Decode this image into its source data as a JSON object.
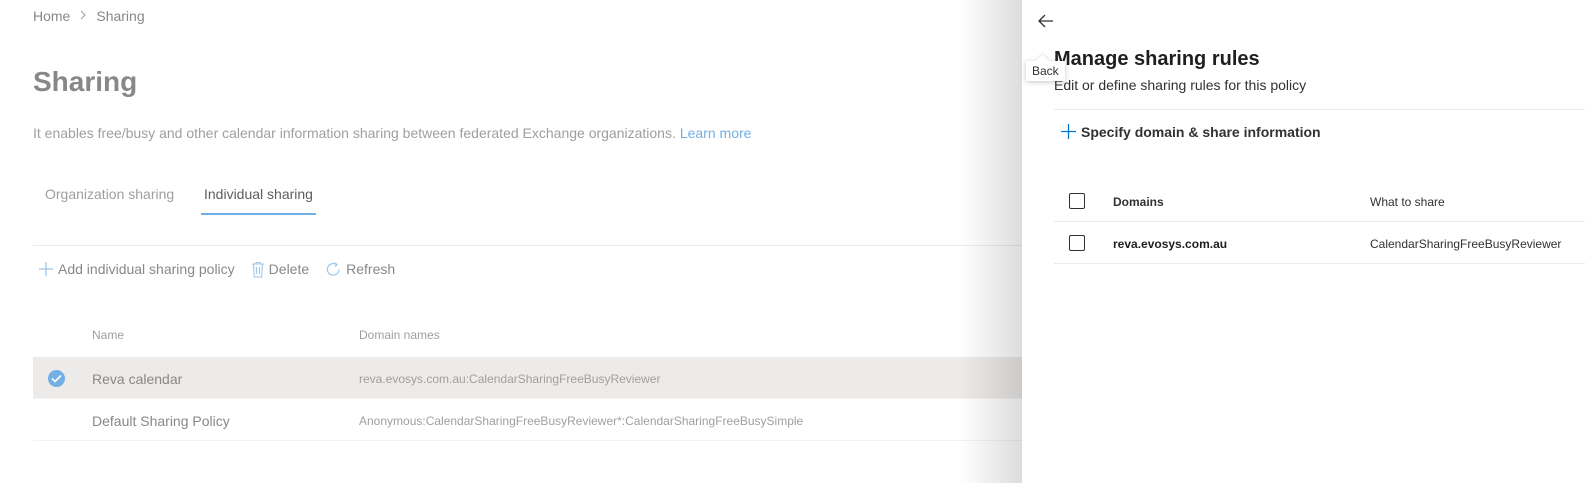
{
  "breadcrumb": {
    "home": "Home",
    "current": "Sharing"
  },
  "page": {
    "title": "Sharing",
    "description": "It enables free/busy and other calendar information sharing between federated Exchange organizations.",
    "learn_more": "Learn more"
  },
  "tabs": [
    {
      "label": "Organization sharing",
      "active": false
    },
    {
      "label": "Individual sharing",
      "active": true
    }
  ],
  "toolbar": {
    "add": "Add individual sharing policy",
    "delete": "Delete",
    "refresh": "Refresh"
  },
  "policies": {
    "columns": {
      "name": "Name",
      "domains": "Domain names"
    },
    "rows": [
      {
        "name": "Reva calendar",
        "domains": "reva.evosys.com.au:CalendarSharingFreeBusyReviewer",
        "selected": true
      },
      {
        "name": "Default Sharing Policy",
        "domains": "Anonymous:CalendarSharingFreeBusyReviewer*:CalendarSharingFreeBusySimple",
        "selected": false
      }
    ]
  },
  "panel": {
    "tooltip": "Back",
    "title": "Manage sharing rules",
    "subtitle": "Edit or define sharing rules for this policy",
    "add_rule": "Specify domain & share information",
    "columns": {
      "domains": "Domains",
      "share": "What to share"
    },
    "rows": [
      {
        "domain": "reva.evosys.com.au",
        "share": "CalendarSharingFreeBusyReviewer"
      }
    ]
  },
  "colors": {
    "accent": "#0078d4",
    "selected_check": "#71afe5"
  }
}
